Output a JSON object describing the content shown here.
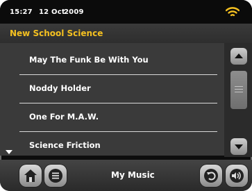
{
  "status": {
    "time": "15:27",
    "date": "12 Oct",
    "year": "2009",
    "wifi_icon": "wifi-icon"
  },
  "header": {
    "title": "New School Science",
    "title_color": "#f4c020"
  },
  "list": {
    "items": [
      {
        "label": "May The Funk Be With You"
      },
      {
        "label": "Noddy Holder"
      },
      {
        "label": "One For M.A.W."
      },
      {
        "label": "Science Friction"
      }
    ]
  },
  "scrollbar": {
    "up_icon": "triangle-up-icon",
    "down_icon": "triangle-down-icon"
  },
  "footer": {
    "label": "My Music",
    "home_icon": "home-icon",
    "menu_icon": "menu-icon",
    "back_icon": "back-icon",
    "volume_icon": "volume-icon"
  }
}
